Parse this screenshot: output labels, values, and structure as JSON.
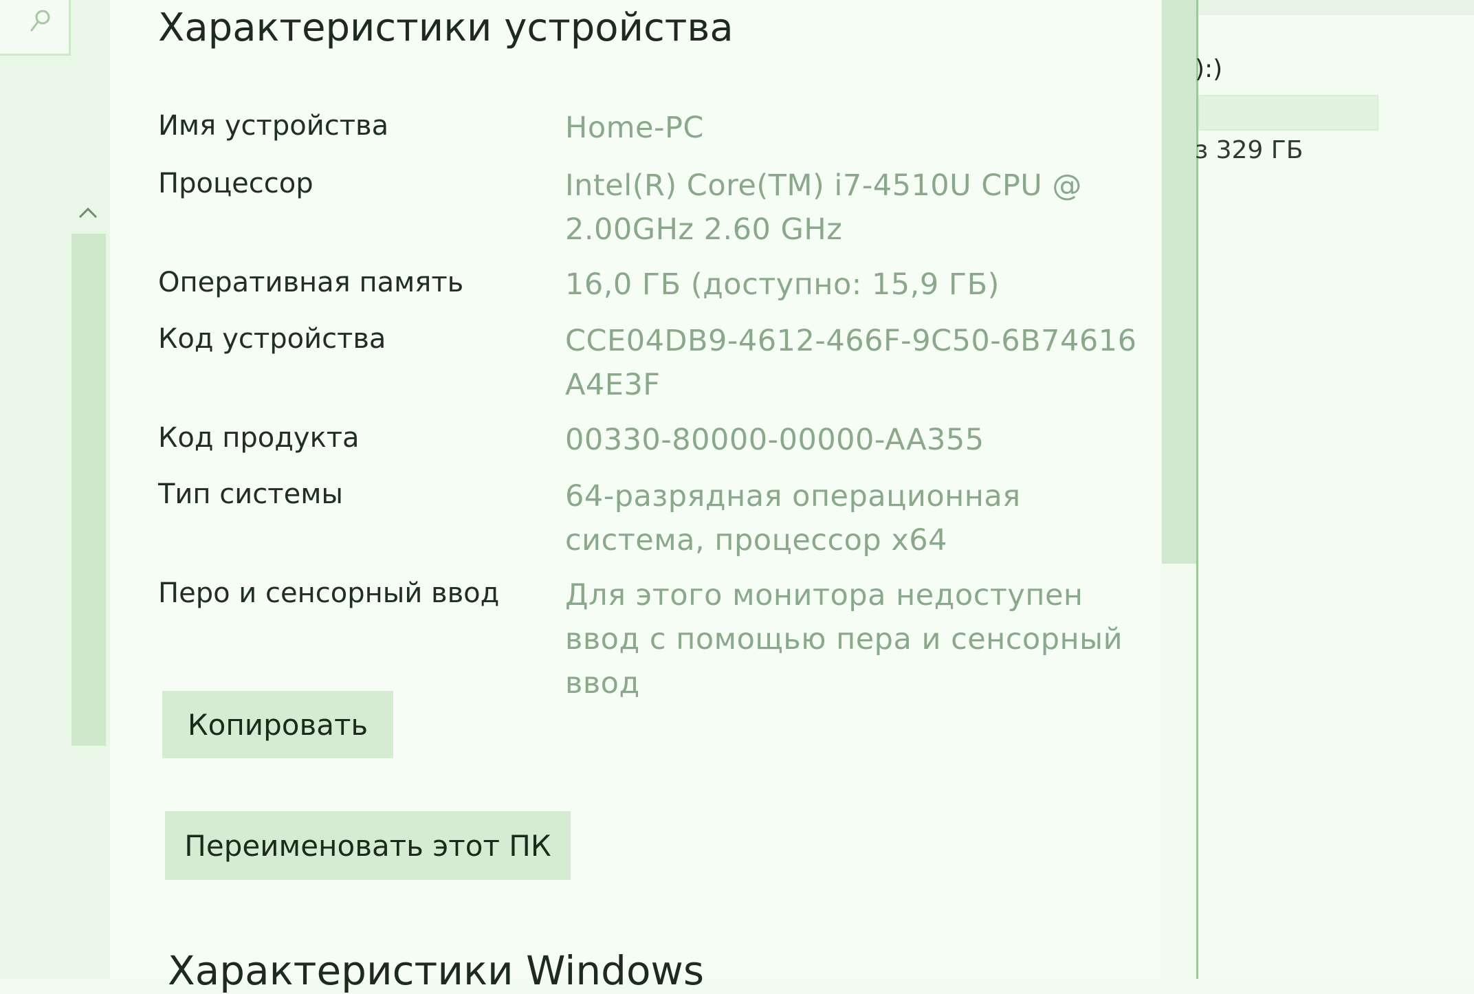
{
  "device_specs": {
    "title": "Характеристики устройства",
    "rows": [
      {
        "label": "Имя устройства",
        "value": "Home-PC"
      },
      {
        "label": "Процессор",
        "value": "Intel(R) Core(TM) i7-4510U CPU @ 2.00GHz   2.60 GHz"
      },
      {
        "label": "Оперативная память",
        "value": "16,0 ГБ (доступно: 15,9 ГБ)"
      },
      {
        "label": "Код устройства",
        "value": "CCE04DB9-4612-466F-9C50-6B74616A4E3F"
      },
      {
        "label": "Код продукта",
        "value": "00330-80000-00000-AA355"
      },
      {
        "label": "Тип системы",
        "value": "64-разрядная операционная система, процессор x64"
      },
      {
        "label": "Перо и сенсорный ввод",
        "value": "Для этого монитора недоступен ввод с помощью пера и сенсорный ввод"
      }
    ],
    "copy_button": "Копировать",
    "rename_button": "Переименовать этот ПК"
  },
  "windows_specs": {
    "title": "Характеристики Windows"
  },
  "right_panel": {
    "drive_label": "):)",
    "drive_free": "з 329 ГБ"
  },
  "icons": {
    "search": "search-icon",
    "scroll_up": "chevron-up-icon"
  }
}
